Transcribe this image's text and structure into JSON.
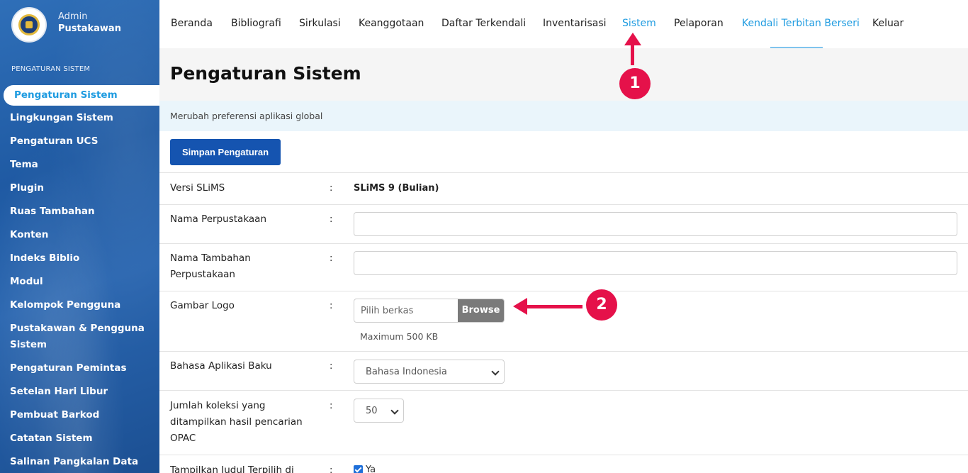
{
  "brand": {
    "role": "Admin",
    "name": "Pustakawan"
  },
  "sidebar": {
    "section": "PENGATURAN SISTEM",
    "items": [
      {
        "label": "Pengaturan Sistem",
        "active": true
      },
      {
        "label": "Lingkungan Sistem"
      },
      {
        "label": "Pengaturan UCS"
      },
      {
        "label": "Tema"
      },
      {
        "label": "Plugin"
      },
      {
        "label": "Ruas Tambahan"
      },
      {
        "label": "Konten"
      },
      {
        "label": "Indeks Biblio"
      },
      {
        "label": "Modul"
      },
      {
        "label": "Kelompok Pengguna"
      },
      {
        "label": "Pustakawan & Pengguna Sistem"
      },
      {
        "label": "Pengaturan Pemintas"
      },
      {
        "label": "Setelan Hari Libur"
      },
      {
        "label": "Pembuat Barkod"
      },
      {
        "label": "Catatan Sistem"
      },
      {
        "label": "Salinan Pangkalan Data"
      }
    ]
  },
  "nav": {
    "items": [
      {
        "label": "Beranda"
      },
      {
        "label": "Bibliografi"
      },
      {
        "label": "Sirkulasi"
      },
      {
        "label": "Keanggotaan"
      },
      {
        "label": "Daftar Terkendali"
      },
      {
        "label": "Inventarisasi"
      },
      {
        "label": "Sistem",
        "accent": true
      },
      {
        "label": "Pelaporan"
      },
      {
        "label": "Kendali Terbitan Berseri",
        "accent": true
      },
      {
        "label": "Keluar"
      }
    ]
  },
  "page": {
    "title": "Pengaturan Sistem",
    "info": "Merubah preferensi aplikasi global",
    "save_label": "Simpan Pengaturan"
  },
  "form": {
    "colon": ":",
    "version": {
      "label": "Versi SLiMS",
      "value": "SLiMS 9 (Bulian)"
    },
    "library_name": {
      "label": "Nama Perpustakaan",
      "value": ""
    },
    "library_subname": {
      "label": "Nama Tambahan Perpustakaan",
      "value": ""
    },
    "logo": {
      "label": "Gambar Logo",
      "placeholder": "Pilih berkas",
      "browse": "Browse",
      "hint": "Maximum 500 KB"
    },
    "language": {
      "label": "Bahasa Aplikasi Baku",
      "selected": "Bahasa Indonesia"
    },
    "opac_count": {
      "label": "Jumlah koleksi yang ditampilkan hasil pencarian OPAC",
      "selected": "50"
    },
    "promoted": {
      "label": "Tampilkan Judul Terpilih di",
      "option": "Ya",
      "checked": true
    }
  },
  "annotations": {
    "badge1": "1",
    "badge2": "2"
  },
  "colors": {
    "accent": "#1e9be0",
    "primary": "#1554b0",
    "annotation": "#e5114a"
  }
}
